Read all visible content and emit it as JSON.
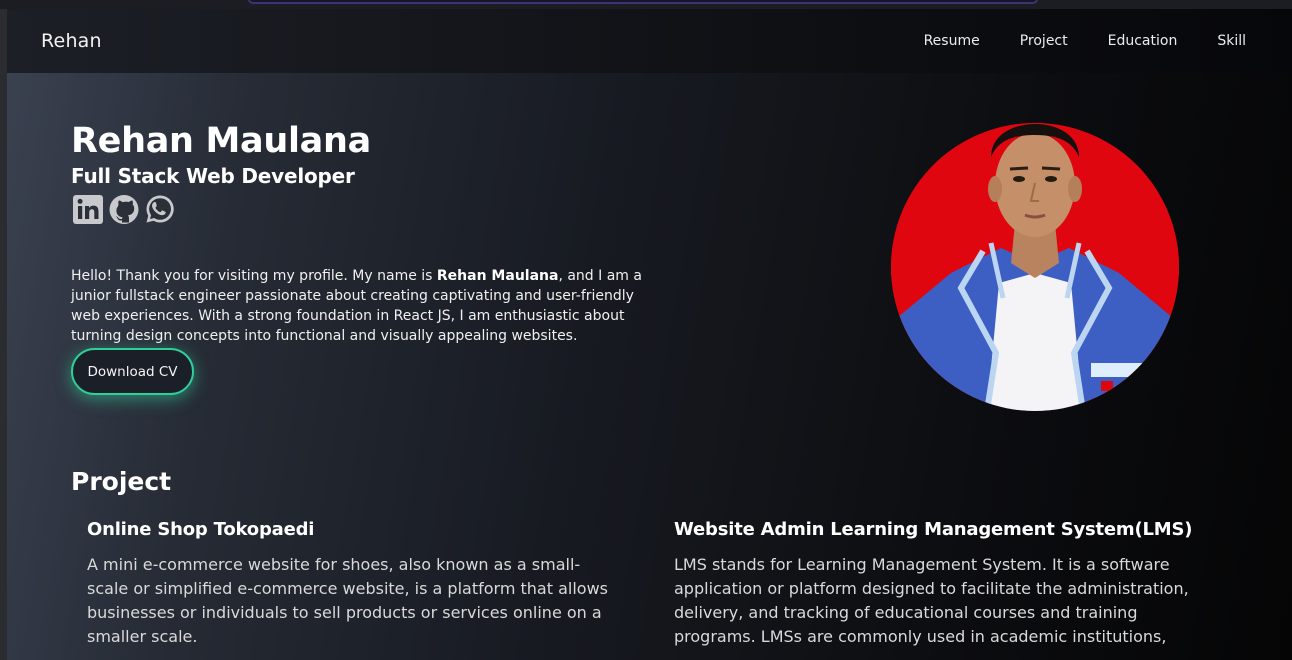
{
  "nav": {
    "brand": "Rehan",
    "links": [
      "Resume",
      "Project",
      "Education",
      "Skill"
    ]
  },
  "hero": {
    "name": "Rehan Maulana",
    "role": "Full Stack Web Developer",
    "socials": [
      "linkedin-icon",
      "github-icon",
      "whatsapp-icon"
    ],
    "bio_prefix": "Hello! Thank you for visiting my profile. My name is ",
    "bio_name": "Rehan Maulana",
    "bio_suffix": ", and I am a junior fullstack engineer passionate about creating captivating and user-friendly web experiences. With a strong foundation in React JS, I am enthusiastic about turning design concepts into functional and visually appealing websites.",
    "cv_button": "Download CV"
  },
  "projects_section": {
    "title": "Project",
    "items": [
      {
        "title": "Online Shop Tokopaedi",
        "description": "A mini e-commerce website for shoes, also known as a small-scale or simplified e-commerce website, is a platform that allows businesses or individuals to sell products or services online on a smaller scale."
      },
      {
        "title": "Website Admin Learning Management System(LMS)",
        "description": "LMS stands for Learning Management System. It is a software application or platform designed to facilitate the administration, delivery, and tracking of educational courses and training programs. LMSs are commonly used in academic institutions,"
      }
    ]
  },
  "colors": {
    "accent": "#2fcf9a",
    "avatar_bg": "#e00610",
    "jacket": "#3d5fc4"
  }
}
